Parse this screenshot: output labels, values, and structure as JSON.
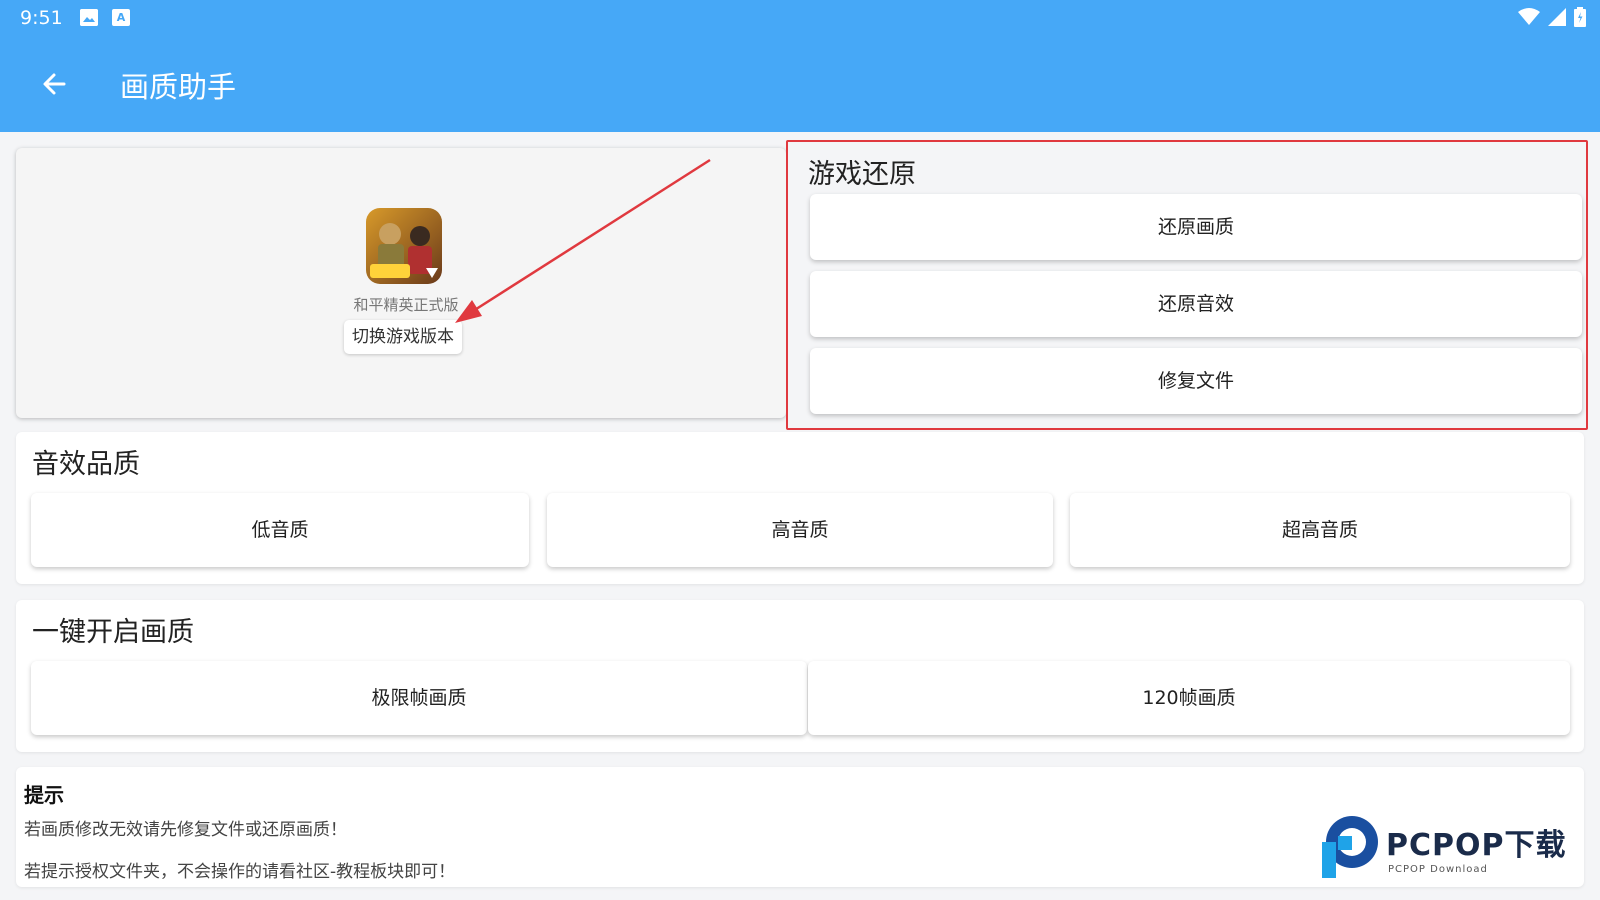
{
  "status_bar": {
    "time": "9:51",
    "icons": [
      "image-icon",
      "a-badge-icon",
      "wifi-icon",
      "signal-icon",
      "battery-icon"
    ],
    "a_badge": "A"
  },
  "app_bar": {
    "title": "画质助手",
    "background": "#46a8f7"
  },
  "game_panel": {
    "game_name": "和平精英正式版",
    "switch_label": "切换游戏版本"
  },
  "restore_section": {
    "title": "游戏还原",
    "buttons": [
      "还原画质",
      "还原音效",
      "修复文件"
    ],
    "highlight_color": "#e0393f"
  },
  "audio_section": {
    "title": "音效品质",
    "buttons": [
      "低音质",
      "高音质",
      "超高音质"
    ]
  },
  "quality_section": {
    "title": "一键开启画质",
    "buttons": [
      "极限帧画质",
      "120帧画质"
    ]
  },
  "hint": {
    "title": "提示",
    "lines": [
      "若画质修改无效请先修复文件或还原画质！",
      "若提示授权文件夹，不会操作的请看社区-教程板块即可！"
    ]
  },
  "watermark": {
    "brand": "PCPOP下载",
    "sub": "PCPOP Download"
  }
}
